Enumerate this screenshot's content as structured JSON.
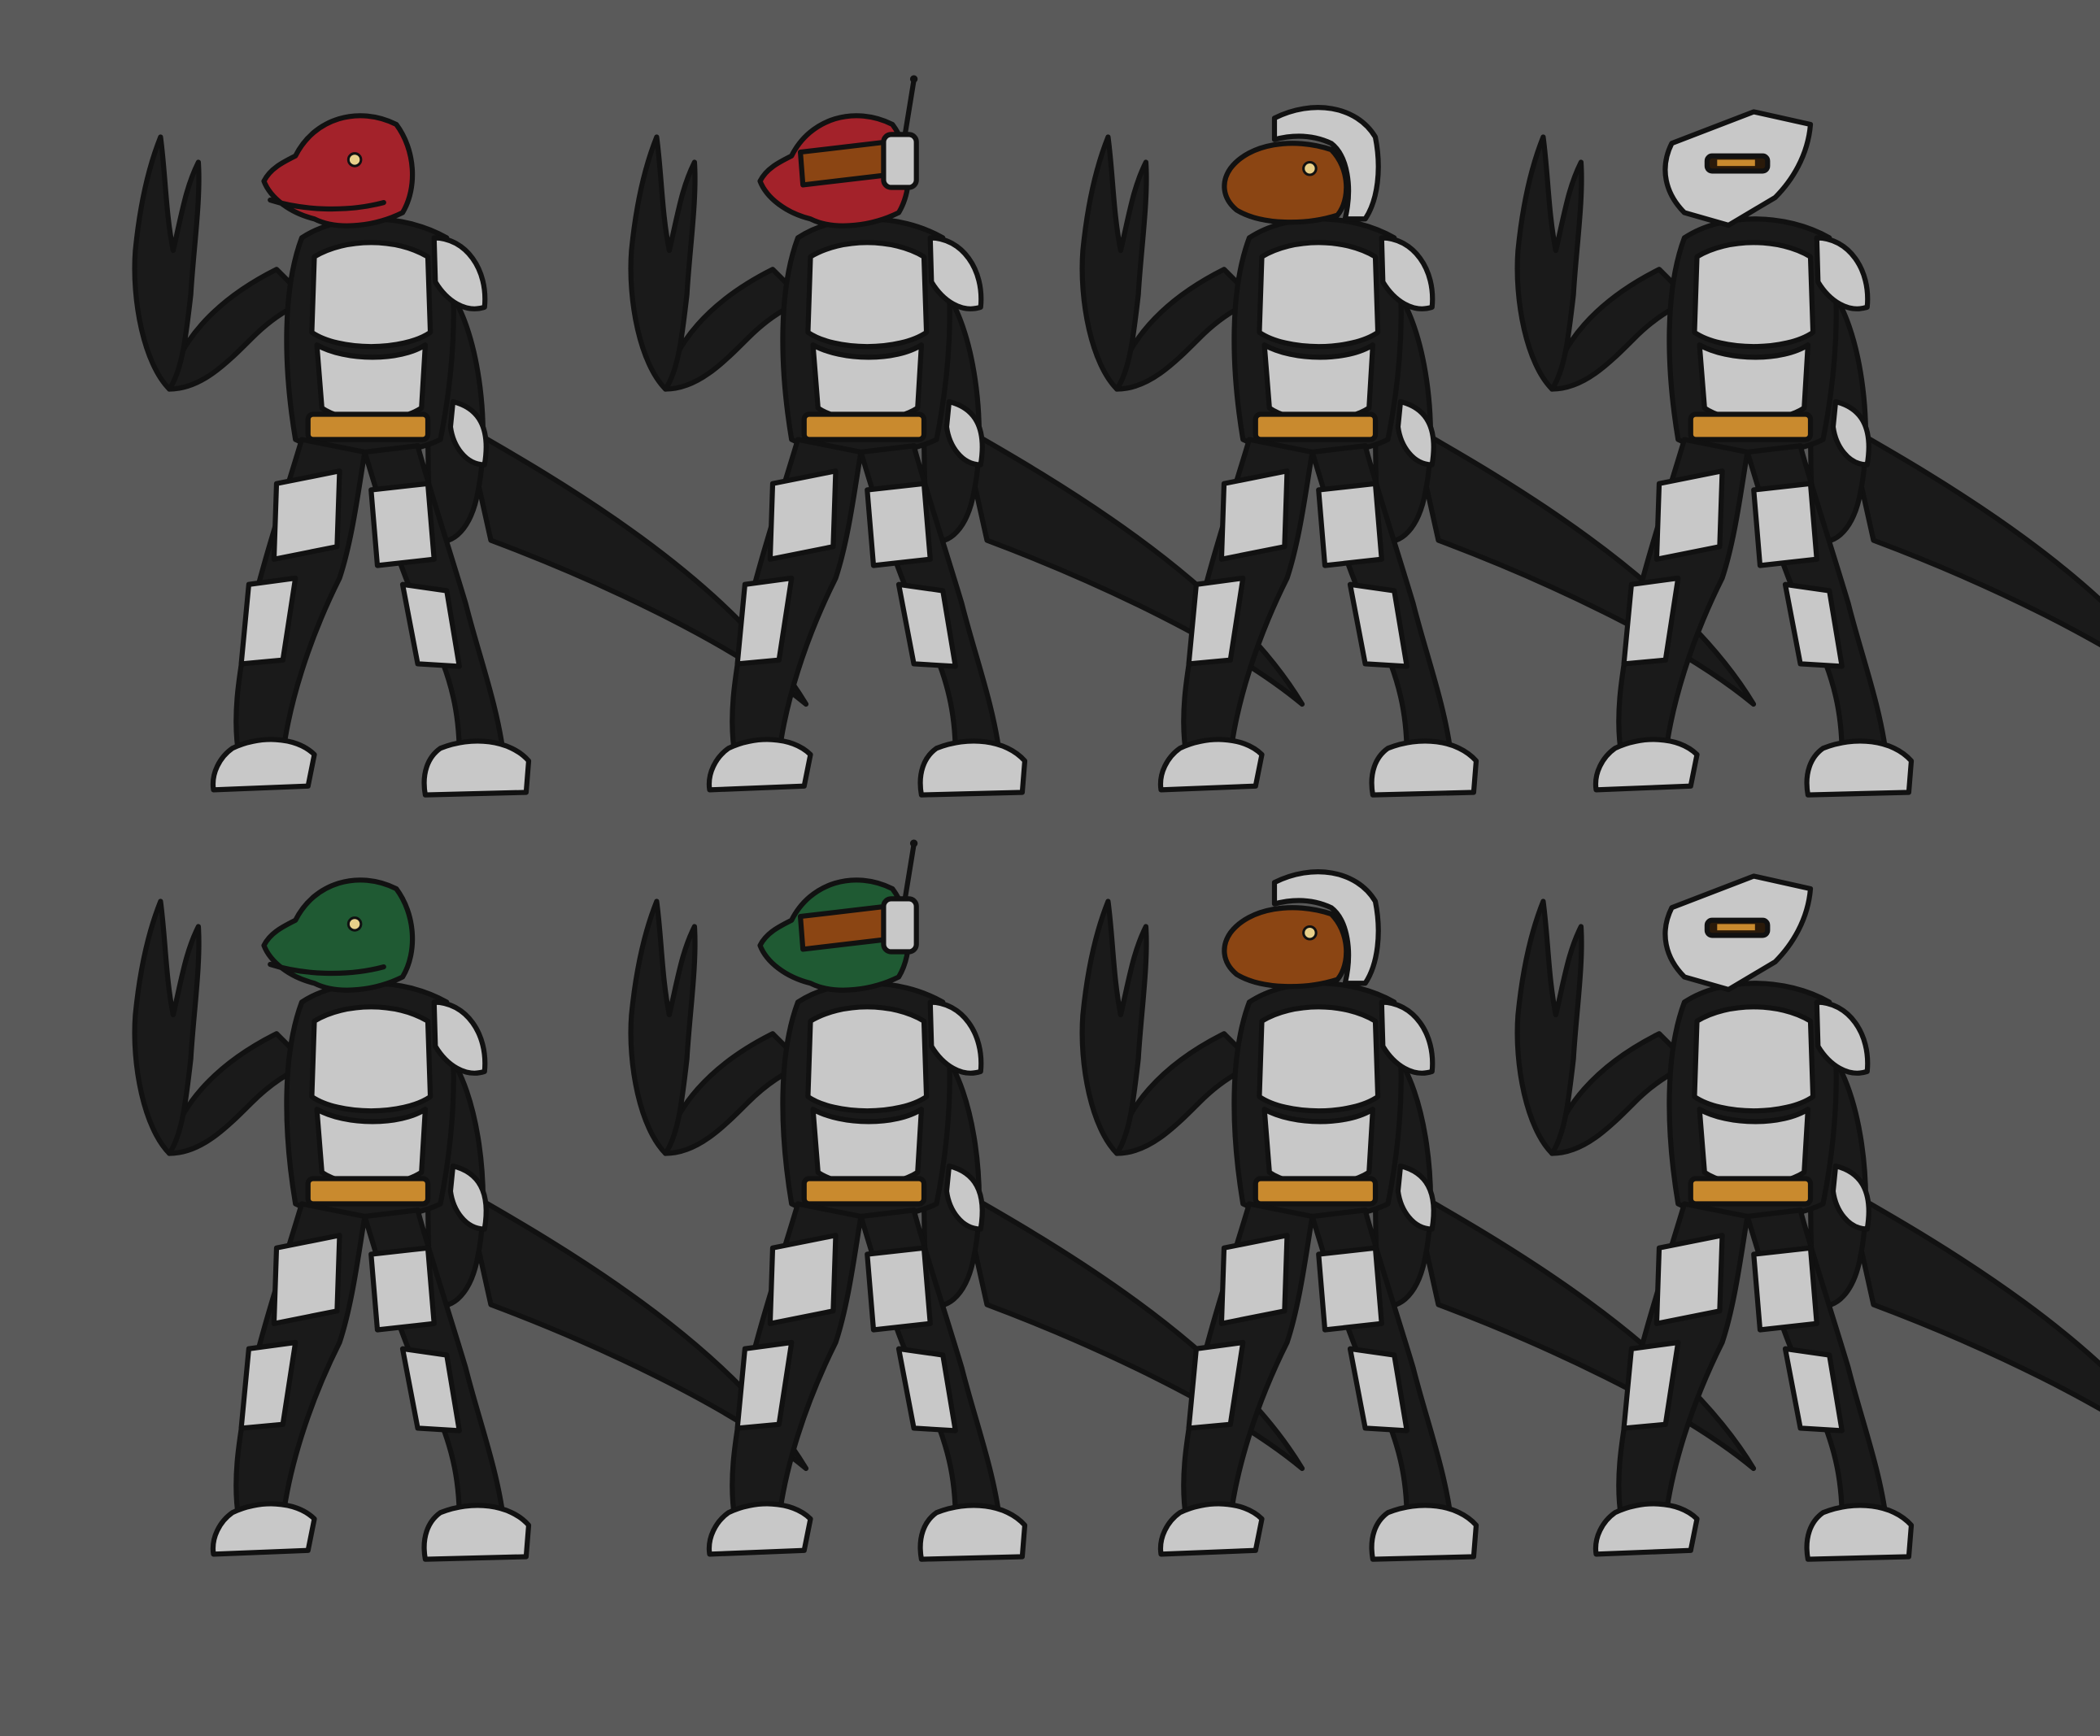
{
  "sheet": {
    "background": "#5a5a5a"
  },
  "palette": {
    "suit": "#1a1a1a",
    "suit_highlight": "#3a3a3a",
    "armor": "#c8c8c8",
    "armor_shade": "#9a9a9a",
    "belt_accent": "#c98a2e",
    "outline": "#111111"
  },
  "rows": [
    {
      "skin": "red",
      "skin_color": "#a3222a",
      "skin_shade": "#7a161c",
      "figures": [
        {
          "headgear": "none"
        },
        {
          "headgear": "visor-with-antenna"
        },
        {
          "headgear": "open-helmet"
        },
        {
          "headgear": "full-helmet"
        }
      ]
    },
    {
      "skin": "green",
      "skin_color": "#1f5a33",
      "skin_shade": "#143f23",
      "figures": [
        {
          "headgear": "none"
        },
        {
          "headgear": "visor-with-antenna"
        },
        {
          "headgear": "open-helmet"
        },
        {
          "headgear": "full-helmet"
        }
      ]
    }
  ]
}
